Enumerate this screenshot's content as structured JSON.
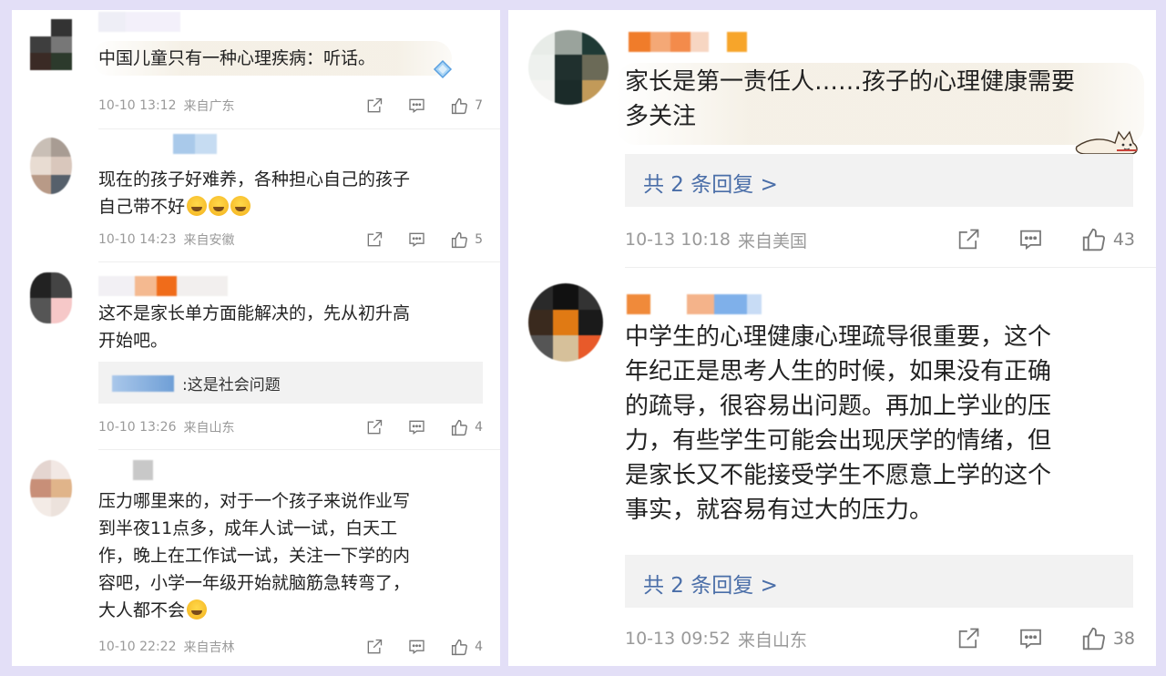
{
  "left_comments": [
    {
      "text": "中国儿童只有一种心理疾病：听话。",
      "time": "10-10 13:12",
      "location": "来自广东",
      "likes": "7"
    },
    {
      "text": "现在的孩子好难养，各种担心自己的孩子\n自己带不好",
      "emoji": [
        "crying-face",
        "crying-face",
        "crying-face"
      ],
      "time": "10-10 14:23",
      "location": "来自安徽",
      "likes": "5"
    },
    {
      "text": "这不是家长单方面能解决的，先从初升高\n开始吧。",
      "reply": ":这是社会问题",
      "time": "10-10 13:26",
      "location": "来自山东",
      "likes": "4"
    },
    {
      "text": "压力哪里来的，对于一个孩子来说作业写\n到半夜11点多，成年人试一试，白天工\n作，晚上在工作试一试，关注一下学的内\n容吧，小学一年级开始就脑筋急转弯了，\n大人都不会",
      "emoji": [
        "crying-face"
      ],
      "time": "10-10 22:22",
      "location": "来自吉林",
      "likes": "4"
    }
  ],
  "right_comments": [
    {
      "text": "家长是第一责任人……孩子的心理健康需要\n多关注",
      "replies_label": "共 2 条回复 >",
      "time": "10-13 10:18",
      "location": "来自美国",
      "likes": "43"
    },
    {
      "text": "中学生的心理健康心理疏导很重要，这个\n年纪正是思考人生的时候，如果没有正确\n的疏导，很容易出问题。再加上学业的压\n力，有些学生可能会出现厌学的情绪，但\n是家长又不能接受学生不愿意上学的这个\n事实，就容易有过大的压力。",
      "replies_label": "共 2 条回复 >",
      "time": "10-13 09:52",
      "location": "来自山东",
      "likes": "38"
    }
  ],
  "icons": {
    "share": "share-icon",
    "comment": "comment-icon",
    "like": "thumbs-up-icon"
  },
  "colors": {
    "background": "#e3dff7",
    "reply_link": "#4a6ea8",
    "meta_text": "#9a9a9a"
  }
}
